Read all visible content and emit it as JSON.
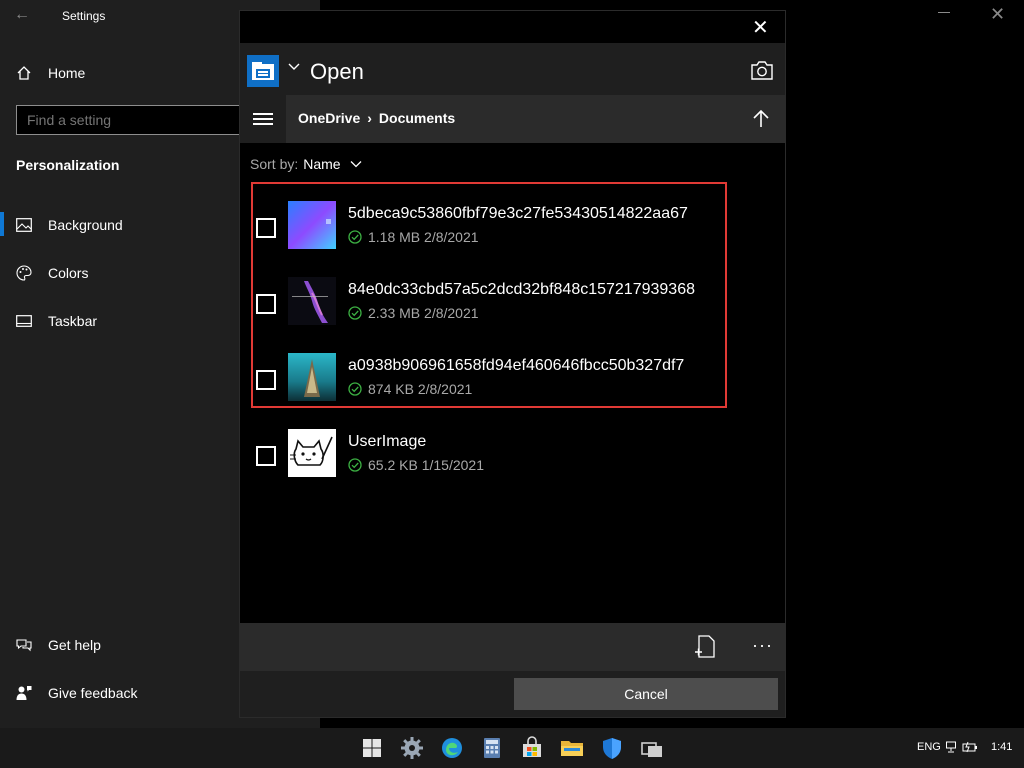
{
  "settings": {
    "title": "Settings",
    "search_placeholder": "Find a setting",
    "home_label": "Home",
    "section": "Personalization",
    "items": [
      {
        "label": "Background"
      },
      {
        "label": "Colors"
      },
      {
        "label": "Taskbar"
      }
    ],
    "footer": [
      {
        "label": "Get help"
      },
      {
        "label": "Give feedback"
      }
    ]
  },
  "picker": {
    "title": "Open",
    "breadcrumb": [
      "OneDrive",
      "Documents"
    ],
    "sort_label": "Sort by:",
    "sort_value": "Name",
    "cancel_label": "Cancel",
    "more_label": "···",
    "files": [
      {
        "name": "5dbeca9c53860fbf79e3c27fe53430514822aa67",
        "size": "1.18 MB",
        "date": "2/8/2021"
      },
      {
        "name": "84e0dc33cbd57a5c2dcd32bf848c157217939368",
        "size": "2.33 MB",
        "date": "2/8/2021"
      },
      {
        "name": "a0938b906961658fd94ef460646fbcc50b327df7",
        "size": "874 KB",
        "date": "2/8/2021"
      },
      {
        "name": "UserImage",
        "size": "65.2 KB",
        "date": "1/15/2021"
      }
    ]
  },
  "taskbar": {
    "language": "ENG",
    "time": "1:41"
  },
  "colors": {
    "accent": "#0f78d4",
    "highlight_border": "#e13a35",
    "sync_check": "#3cb043"
  }
}
